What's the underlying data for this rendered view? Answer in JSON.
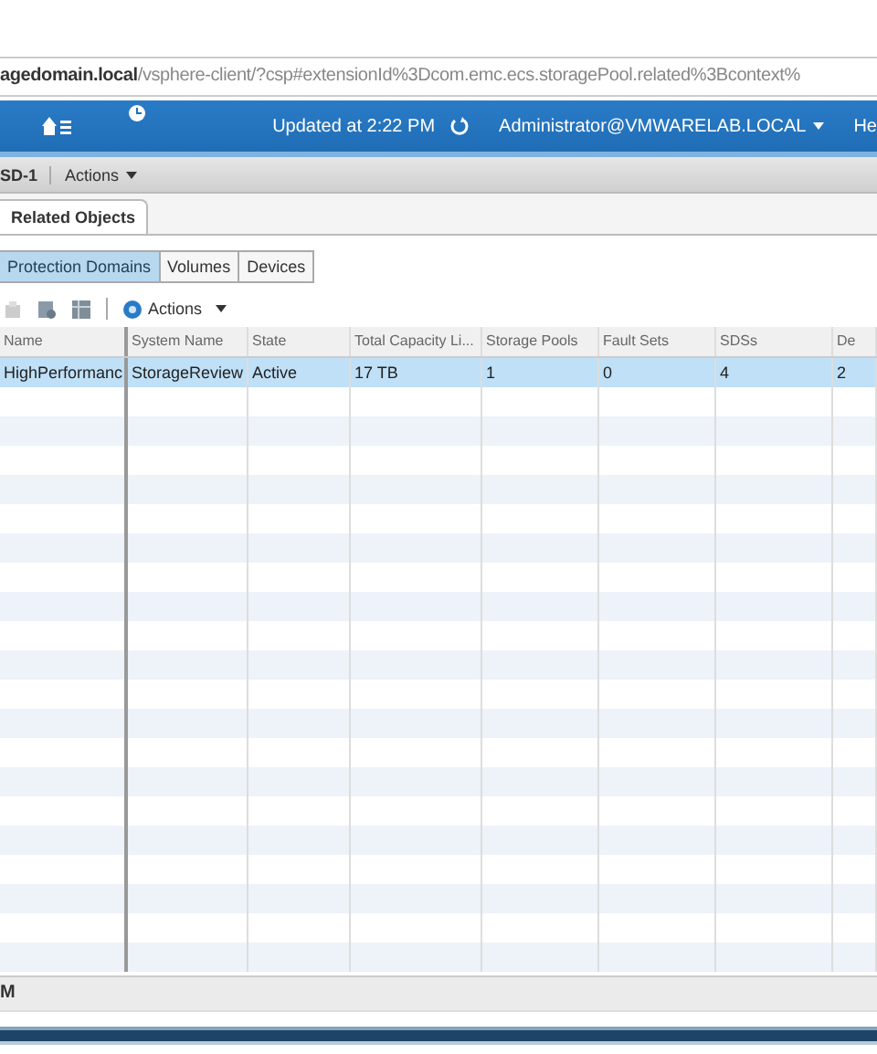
{
  "address_bar": {
    "url": "**agedomain.local**/vsphere-client/?csp#extensionId%3Dcom.emc.ecs.storagePool.related%3Bcontext%"
  },
  "header": {
    "updated": "Updated at 2:22 PM",
    "user": "Administrator@VMWARELAB.LOCAL",
    "help": "He"
  },
  "object_bar": {
    "name": "SD-1",
    "actions": "Actions"
  },
  "tabs": [
    {
      "label": "Related Objects",
      "selected": true
    }
  ],
  "sub_tabs": [
    {
      "label": "Protection Domains",
      "selected": true
    },
    {
      "label": "Volumes",
      "selected": false
    },
    {
      "label": "Devices",
      "selected": false
    }
  ],
  "toolbar": {
    "actions": "Actions"
  },
  "table": {
    "columns": [
      "Name",
      "System Name",
      "State",
      "Total Capacity Li...",
      "Storage Pools",
      "Fault Sets",
      "SDSs",
      "De"
    ],
    "rows": [
      {
        "cells": [
          "HighPerformanc",
          "StorageReview",
          "Active",
          "17 TB",
          "1",
          "0",
          "4",
          "2"
        ],
        "selected": true
      }
    ]
  },
  "status_bar": {
    "text": "M"
  }
}
